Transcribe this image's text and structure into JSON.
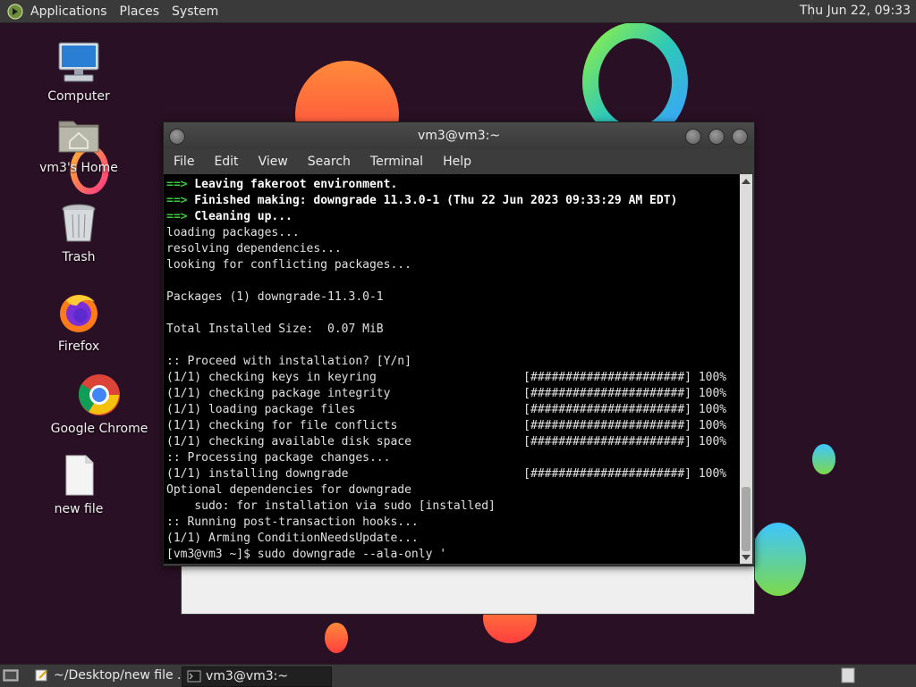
{
  "top_panel": {
    "menus": [
      "Applications",
      "Places",
      "System"
    ],
    "clock": "Thu Jun 22, 09:33"
  },
  "desktop": {
    "icons": [
      {
        "label": "Computer",
        "icon": "computer-icon"
      },
      {
        "label": "vm3's Home",
        "icon": "home-folder-icon"
      },
      {
        "label": "Trash",
        "icon": "trash-icon"
      },
      {
        "label": "Firefox",
        "icon": "firefox-icon"
      },
      {
        "label": "Google Chrome",
        "icon": "chrome-icon"
      },
      {
        "label": "new file",
        "icon": "file-icon"
      }
    ]
  },
  "terminal": {
    "title": "vm3@vm3:~",
    "menu": [
      "File",
      "Edit",
      "View",
      "Search",
      "Terminal",
      "Help"
    ],
    "lines": [
      {
        "prefix": "==>",
        "text": " Leaving fakeroot environment.",
        "style": "bold"
      },
      {
        "prefix": "==>",
        "text": " Finished making: downgrade 11.3.0-1 (Thu 22 Jun 2023 09:33:29 AM EDT)",
        "style": "bold"
      },
      {
        "prefix": "==>",
        "text": " Cleaning up...",
        "style": "bold"
      },
      {
        "prefix": "",
        "text": "loading packages...",
        "style": ""
      },
      {
        "prefix": "",
        "text": "resolving dependencies...",
        "style": ""
      },
      {
        "prefix": "",
        "text": "looking for conflicting packages...",
        "style": ""
      },
      {
        "prefix": "",
        "text": "",
        "style": ""
      },
      {
        "prefix": "",
        "text": "Packages (1) downgrade-11.3.0-1",
        "style": ""
      },
      {
        "prefix": "",
        "text": "",
        "style": ""
      },
      {
        "prefix": "",
        "text": "Total Installed Size:  0.07 MiB",
        "style": ""
      },
      {
        "prefix": "",
        "text": "",
        "style": ""
      },
      {
        "prefix": "",
        "text": ":: Proceed with installation? [Y/n]",
        "style": ""
      },
      {
        "prefix": "",
        "text": "(1/1) checking keys in keyring                     [######################] 100%",
        "style": ""
      },
      {
        "prefix": "",
        "text": "(1/1) checking package integrity                   [######################] 100%",
        "style": ""
      },
      {
        "prefix": "",
        "text": "(1/1) loading package files                        [######################] 100%",
        "style": ""
      },
      {
        "prefix": "",
        "text": "(1/1) checking for file conflicts                  [######################] 100%",
        "style": ""
      },
      {
        "prefix": "",
        "text": "(1/1) checking available disk space                [######################] 100%",
        "style": ""
      },
      {
        "prefix": "",
        "text": ":: Processing package changes...",
        "style": ""
      },
      {
        "prefix": "",
        "text": "(1/1) installing downgrade                         [######################] 100%",
        "style": ""
      },
      {
        "prefix": "",
        "text": "Optional dependencies for downgrade",
        "style": ""
      },
      {
        "prefix": "",
        "text": "    sudo: for installation via sudo [installed]",
        "style": ""
      },
      {
        "prefix": "",
        "text": ":: Running post-transaction hooks...",
        "style": ""
      },
      {
        "prefix": "",
        "text": "(1/1) Arming ConditionNeedsUpdate...",
        "style": ""
      },
      {
        "prefix": "",
        "text": "[vm3@vm3 ~]$ sudo downgrade --ala-only '",
        "style": ""
      }
    ]
  },
  "taskbar": {
    "tasks": [
      {
        "label": "~/Desktop/new file ...",
        "icon": "text-editor-icon",
        "active": false
      },
      {
        "label": "vm3@vm3:~",
        "icon": "terminal-icon",
        "active": true
      }
    ]
  },
  "colors": {
    "wallpaper": "#2a1024",
    "panel": "#3a3a3a",
    "terminal_bg": "#000000",
    "prompt_green": "#3cc93c"
  }
}
